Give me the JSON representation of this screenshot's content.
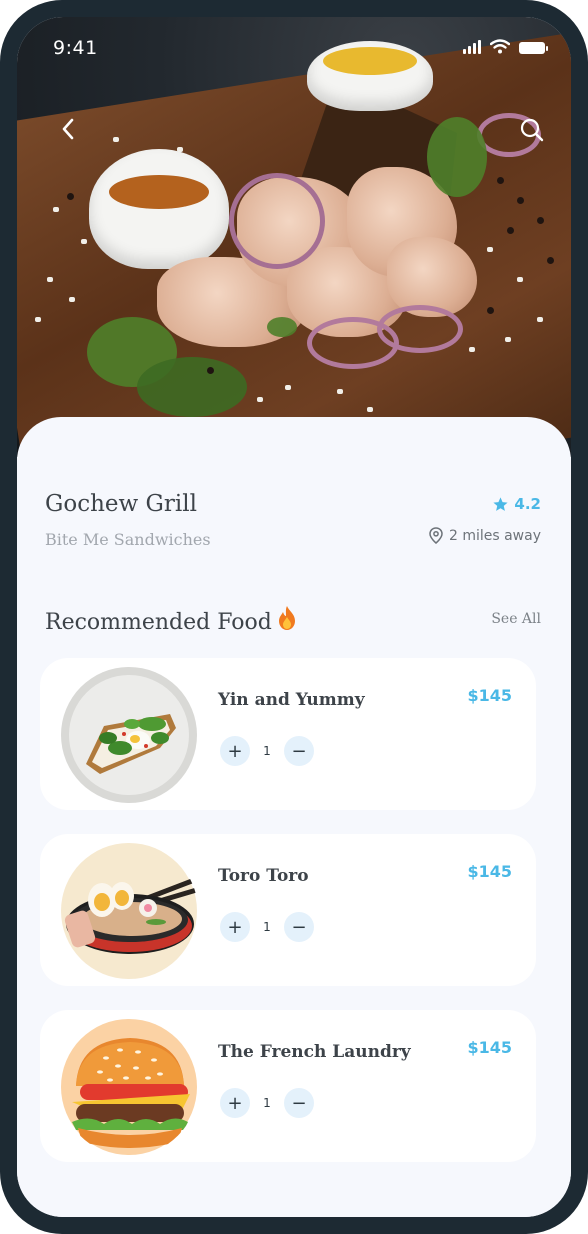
{
  "status_bar": {
    "time": "9:41"
  },
  "restaurant": {
    "name": "Gochew Grill",
    "subtitle": "Bite Me Sandwiches",
    "rating": "4.2",
    "distance": "2 miles away"
  },
  "section": {
    "title": "Recommended Food",
    "see_all": "See All"
  },
  "items": [
    {
      "name": "Yin and Yummy",
      "price": "$145",
      "quantity": "1"
    },
    {
      "name": "Toro Toro",
      "price": "$145",
      "quantity": "1"
    },
    {
      "name": "The French Laundry",
      "price": "$145",
      "quantity": "1"
    }
  ],
  "stepper": {
    "plus": "+",
    "minus": "−"
  },
  "colors": {
    "accent": "#4ab8e6",
    "frame": "#1d2a33",
    "background": "#f6f8fd",
    "text": "#3d4349"
  },
  "icons": [
    "back-arrow-icon",
    "search-icon",
    "star-icon",
    "location-pin-icon",
    "fire-icon",
    "signal-icon",
    "wifi-icon",
    "battery-icon"
  ]
}
